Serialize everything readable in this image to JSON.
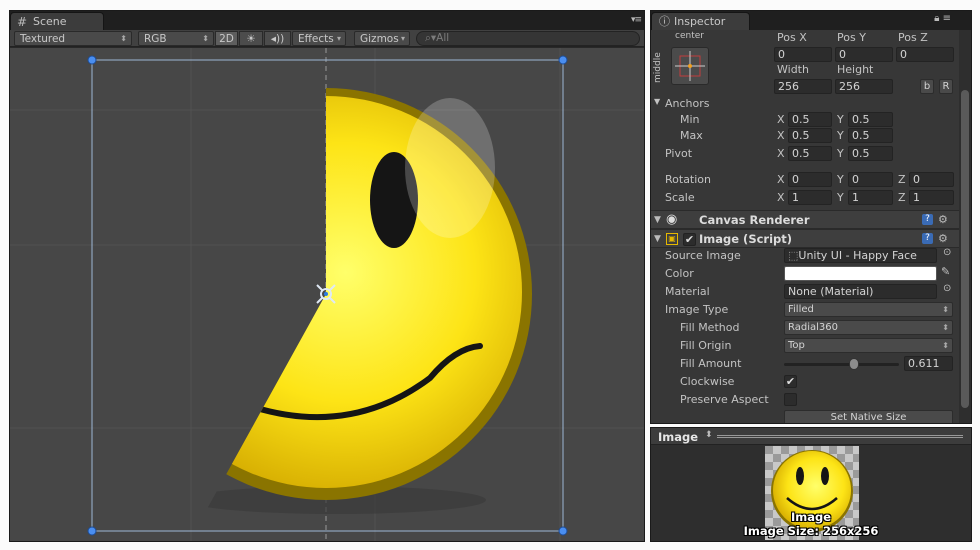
{
  "scene": {
    "tab_label": "Scene",
    "toolbar": {
      "shading_mode": "Textured",
      "render_mode": "RGB",
      "mode_2d": "2D",
      "effects_label": "Effects",
      "gizmos_label": "Gizmos",
      "search_placeholder": "All"
    }
  },
  "inspector": {
    "tab_label": "Inspector",
    "anchor_preset": {
      "horizontal": "center",
      "vertical": "middle"
    },
    "rect": {
      "pos_x_label": "Pos X",
      "pos_y_label": "Pos Y",
      "pos_z_label": "Pos Z",
      "pos_x": "0",
      "pos_y": "0",
      "pos_z": "0",
      "width_label": "Width",
      "height_label": "Height",
      "width": "256",
      "height": "256",
      "blueprint_btn": "b",
      "raw_btn": "R"
    },
    "anchors": {
      "label": "Anchors",
      "min_label": "Min",
      "min_x": "0.5",
      "min_y": "0.5",
      "max_label": "Max",
      "max_x": "0.5",
      "max_y": "0.5"
    },
    "pivot": {
      "label": "Pivot",
      "x": "0.5",
      "y": "0.5"
    },
    "rotation": {
      "label": "Rotation",
      "x": "0",
      "y": "0",
      "z": "0"
    },
    "scale": {
      "label": "Scale",
      "x": "1",
      "y": "1",
      "z": "1"
    },
    "axis": {
      "x": "X",
      "y": "Y",
      "z": "Z"
    },
    "canvas_renderer": {
      "title": "Canvas Renderer"
    },
    "image_script": {
      "title": "Image (Script)",
      "source_image_label": "Source Image",
      "source_image": "Unity UI - Happy Face",
      "color_label": "Color",
      "color_value": "#ffffff",
      "material_label": "Material",
      "material": "None (Material)",
      "image_type_label": "Image Type",
      "image_type": "Filled",
      "fill_method_label": "Fill Method",
      "fill_method": "Radial360",
      "fill_origin_label": "Fill Origin",
      "fill_origin": "Top",
      "fill_amount_label": "Fill Amount",
      "fill_amount": "0.611",
      "fill_amount_value": 0.611,
      "clockwise_label": "Clockwise",
      "clockwise": true,
      "preserve_aspect_label": "Preserve Aspect",
      "preserve_aspect": false,
      "set_native_size": "Set Native Size"
    }
  },
  "preview": {
    "title": "Image",
    "caption_name": "Image",
    "caption_size": "Image Size: 256x256"
  }
}
